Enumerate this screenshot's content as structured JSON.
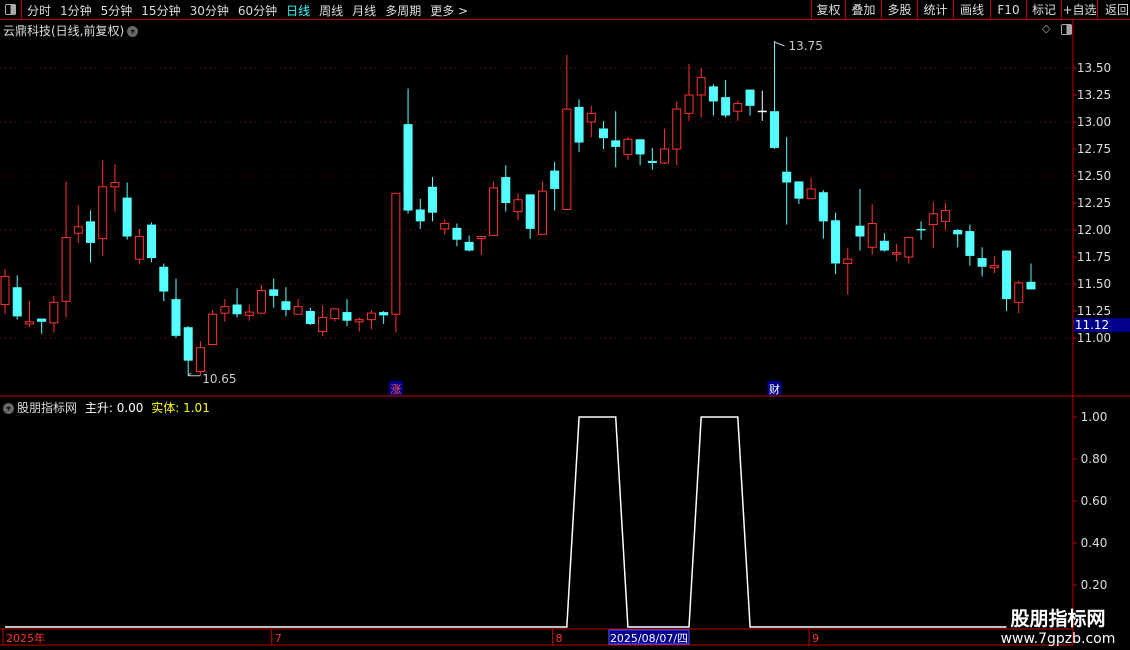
{
  "toolbar": {
    "layout_icon": "panel-toggle-icon",
    "tabs": [
      {
        "label": "分时",
        "active": false
      },
      {
        "label": "1分钟",
        "active": false
      },
      {
        "label": "5分钟",
        "active": false
      },
      {
        "label": "15分钟",
        "active": false
      },
      {
        "label": "30分钟",
        "active": false
      },
      {
        "label": "60分钟",
        "active": false
      },
      {
        "label": "日线",
        "active": true
      },
      {
        "label": "周线",
        "active": false
      },
      {
        "label": "月线",
        "active": false
      },
      {
        "label": "多周期",
        "active": false
      },
      {
        "label": "更多 >",
        "active": false
      }
    ],
    "buttons": [
      "复权",
      "叠加",
      "多股",
      "统计",
      "画线",
      "F10",
      "标记",
      "+自选",
      "返回"
    ]
  },
  "main_pane": {
    "title": "云鼎科技(日线,前复权)",
    "price_ticks": [
      "13.50",
      "13.25",
      "13.00",
      "12.75",
      "12.50",
      "12.25",
      "12.00",
      "11.75",
      "11.50",
      "11.25",
      "11.00"
    ],
    "current_price": "11.12",
    "high_label": "13.75",
    "low_label": "10.65",
    "markers": [
      {
        "text": "涨",
        "index": 32
      },
      {
        "text": "财",
        "index": 63
      }
    ],
    "colors": {
      "up": "#ff3232",
      "down": "#54ffff",
      "flat": "#ffffff",
      "grid": "#8b0000",
      "price_tag_bg": "#00008b"
    }
  },
  "chart_data": {
    "type": "candlestick",
    "ylim": [
      10.6,
      13.8
    ],
    "ohlc": [
      [
        11.31,
        11.64,
        11.22,
        11.57
      ],
      [
        11.47,
        11.58,
        11.17,
        11.2
      ],
      [
        11.13,
        11.34,
        11.1,
        11.15
      ],
      [
        11.18,
        11.18,
        11.04,
        11.15
      ],
      [
        11.14,
        11.39,
        11.05,
        11.33
      ],
      [
        11.34,
        12.45,
        11.19,
        11.93
      ],
      [
        11.97,
        12.23,
        11.88,
        12.03
      ],
      [
        12.08,
        12.18,
        11.7,
        11.88
      ],
      [
        11.92,
        12.65,
        11.76,
        12.4
      ],
      [
        12.4,
        12.61,
        12.17,
        12.44
      ],
      [
        12.3,
        12.44,
        11.91,
        11.94
      ],
      [
        11.73,
        12.01,
        11.69,
        11.94
      ],
      [
        12.05,
        12.07,
        11.7,
        11.74
      ],
      [
        11.66,
        11.69,
        11.34,
        11.43
      ],
      [
        11.36,
        11.55,
        11.0,
        11.02
      ],
      [
        11.1,
        11.11,
        10.65,
        10.79
      ],
      [
        10.69,
        10.97,
        10.65,
        10.91
      ],
      [
        10.94,
        11.26,
        10.94,
        11.22
      ],
      [
        11.23,
        11.36,
        11.15,
        11.29
      ],
      [
        11.31,
        11.46,
        11.19,
        11.22
      ],
      [
        11.21,
        11.31,
        11.16,
        11.24
      ],
      [
        11.23,
        11.49,
        11.22,
        11.44
      ],
      [
        11.45,
        11.55,
        11.28,
        11.39
      ],
      [
        11.34,
        11.47,
        11.2,
        11.26
      ],
      [
        11.22,
        11.36,
        11.22,
        11.29
      ],
      [
        11.25,
        11.28,
        11.12,
        11.13
      ],
      [
        11.06,
        11.3,
        11.02,
        11.19
      ],
      [
        11.18,
        11.27,
        11.15,
        11.27
      ],
      [
        11.24,
        11.36,
        11.11,
        11.16
      ],
      [
        11.15,
        11.19,
        11.06,
        11.17
      ],
      [
        11.17,
        11.26,
        11.08,
        11.23
      ],
      [
        11.24,
        11.25,
        11.13,
        11.21
      ],
      [
        11.22,
        12.34,
        11.05,
        12.34
      ],
      [
        12.98,
        13.31,
        12.15,
        12.18
      ],
      [
        12.19,
        12.29,
        12.01,
        12.08
      ],
      [
        12.4,
        12.49,
        12.08,
        12.16
      ],
      [
        12.01,
        12.1,
        11.96,
        12.06
      ],
      [
        12.02,
        12.06,
        11.85,
        11.91
      ],
      [
        11.89,
        11.95,
        11.8,
        11.81
      ],
      [
        11.92,
        11.94,
        11.77,
        11.94
      ],
      [
        11.95,
        12.45,
        11.95,
        12.39
      ],
      [
        12.49,
        12.6,
        12.17,
        12.25
      ],
      [
        12.17,
        12.34,
        12.09,
        12.28
      ],
      [
        12.33,
        12.33,
        11.92,
        12.01
      ],
      [
        11.96,
        12.45,
        11.96,
        12.36
      ],
      [
        12.55,
        12.63,
        12.18,
        12.38
      ],
      [
        12.19,
        13.62,
        12.19,
        13.12
      ],
      [
        13.14,
        13.21,
        12.72,
        12.81
      ],
      [
        13.0,
        13.15,
        12.86,
        13.08
      ],
      [
        12.94,
        13.01,
        12.75,
        12.85
      ],
      [
        12.83,
        13.1,
        12.58,
        12.77
      ],
      [
        12.7,
        12.86,
        12.65,
        12.84
      ],
      [
        12.84,
        12.84,
        12.6,
        12.7
      ],
      [
        12.64,
        12.76,
        12.56,
        12.62
      ],
      [
        12.62,
        12.94,
        12.61,
        12.75
      ],
      [
        12.75,
        13.19,
        12.6,
        13.12
      ],
      [
        13.08,
        13.54,
        13.01,
        13.25
      ],
      [
        13.25,
        13.5,
        13.04,
        13.41
      ],
      [
        13.33,
        13.35,
        13.06,
        13.19
      ],
      [
        13.23,
        13.39,
        13.04,
        13.06
      ],
      [
        13.1,
        13.2,
        13.01,
        13.17
      ],
      [
        13.3,
        13.3,
        13.06,
        13.15
      ],
      [
        13.1,
        13.29,
        13.01,
        13.1
      ],
      [
        13.1,
        13.75,
        12.75,
        12.76
      ],
      [
        12.54,
        12.86,
        12.05,
        12.44
      ],
      [
        12.45,
        12.45,
        12.24,
        12.29
      ],
      [
        12.29,
        12.48,
        12.29,
        12.38
      ],
      [
        12.35,
        12.37,
        11.92,
        12.08
      ],
      [
        12.09,
        12.16,
        11.59,
        11.69
      ],
      [
        11.69,
        11.83,
        11.4,
        11.73
      ],
      [
        12.04,
        12.38,
        11.81,
        11.94
      ],
      [
        11.84,
        12.24,
        11.77,
        12.06
      ],
      [
        11.9,
        11.97,
        11.8,
        11.81
      ],
      [
        11.78,
        11.87,
        11.71,
        11.79
      ],
      [
        11.75,
        11.93,
        11.69,
        11.93
      ],
      [
        12.01,
        12.08,
        11.91,
        12.0
      ],
      [
        12.05,
        12.26,
        11.83,
        12.15
      ],
      [
        12.08,
        12.25,
        12.0,
        12.18
      ],
      [
        12.0,
        12.01,
        11.84,
        11.96
      ],
      [
        11.99,
        12.05,
        11.67,
        11.76
      ],
      [
        11.74,
        11.84,
        11.57,
        11.66
      ],
      [
        11.65,
        11.76,
        11.6,
        11.67
      ],
      [
        11.81,
        11.81,
        11.25,
        11.36
      ],
      [
        11.33,
        11.53,
        11.23,
        11.51
      ],
      [
        11.52,
        11.69,
        11.45,
        11.45
      ]
    ],
    "indicator": {
      "ylim": [
        0,
        1.05
      ],
      "ticks": [
        "1.00",
        "0.80",
        "0.60",
        "0.40",
        "0.20"
      ],
      "values": [
        0,
        0,
        0,
        0,
        0,
        0,
        0,
        0,
        0,
        0,
        0,
        0,
        0,
        0,
        0,
        0,
        0,
        0,
        0,
        0,
        0,
        0,
        0,
        0,
        0,
        0,
        0,
        0,
        0,
        0,
        0,
        0,
        0,
        0,
        0,
        0,
        0,
        0,
        0,
        0,
        0,
        0,
        0,
        0,
        0,
        0,
        0,
        1,
        1,
        1,
        1,
        0,
        0,
        0,
        0,
        0,
        0,
        1,
        1,
        1,
        1,
        0,
        0,
        0,
        0,
        0,
        0,
        0,
        0,
        0,
        0,
        0,
        0,
        0,
        0,
        0,
        0,
        0,
        0,
        0,
        0,
        0,
        0
      ]
    },
    "x_axis": {
      "labels": [
        {
          "text": "2025年",
          "index": 0
        },
        {
          "text": "7",
          "index": 22
        },
        {
          "text": "8",
          "index": 45
        },
        {
          "text": "9",
          "index": 66
        }
      ],
      "selected_date": "2025/08/07/四"
    }
  },
  "indicator_pane": {
    "name": "股朋指标网",
    "series": [
      {
        "label": "主升: 0.00",
        "color": "#ffffff"
      },
      {
        "label": "实体: 1.01",
        "color": "#ffff00"
      }
    ]
  },
  "watermark": {
    "line1": "股朋指标网",
    "line2": "www.7gpzb.com"
  }
}
